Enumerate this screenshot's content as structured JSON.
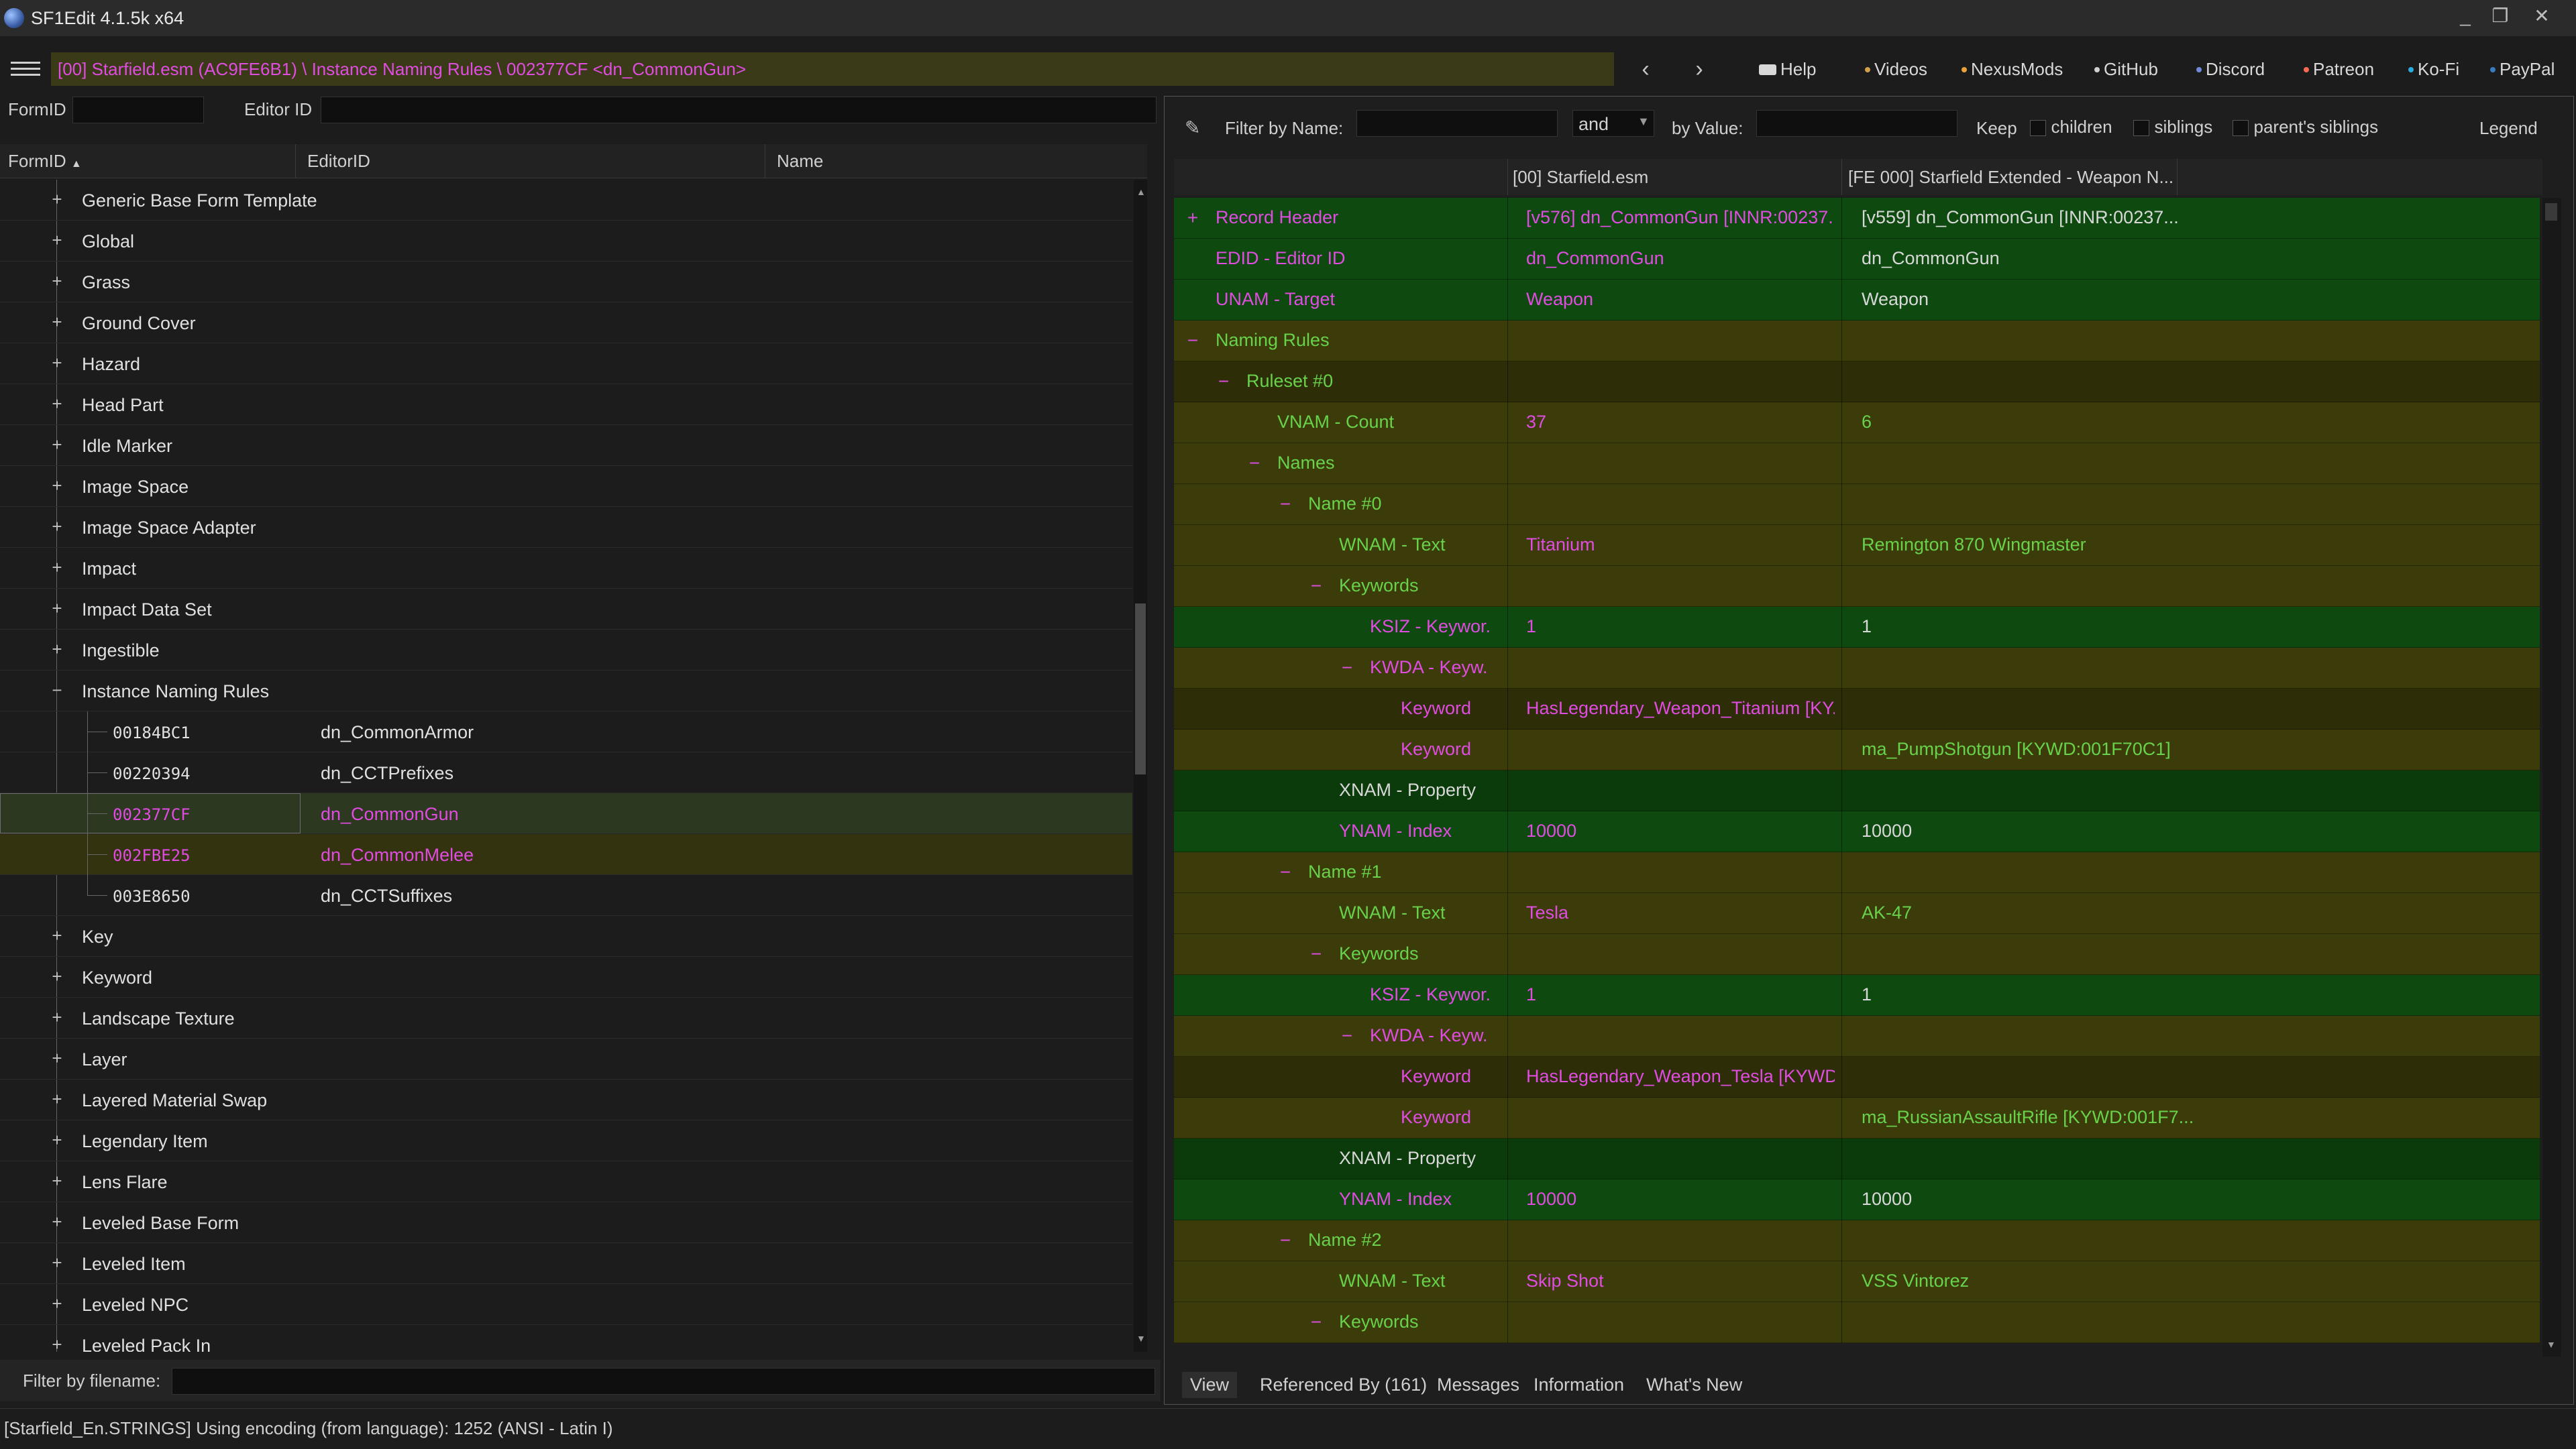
{
  "window": {
    "title": "SF1Edit 4.1.5k x64",
    "minimize": "_",
    "restore": "❐",
    "close": "✕"
  },
  "breadcrumb": "[00] Starfield.esm (AC9FE6B1) \\ Instance Naming Rules \\ 002377CF <dn_CommonGun>",
  "nav": {
    "back": "‹",
    "forward": "›"
  },
  "links": [
    {
      "label": "Help",
      "icon": "book-icon",
      "color": "#d8d8d8"
    },
    {
      "label": "Videos",
      "icon": "video-icon",
      "color": "#cfa04a"
    },
    {
      "label": "NexusMods",
      "icon": "nexus-icon",
      "color": "#e8a23a"
    },
    {
      "label": "GitHub",
      "icon": "github-icon",
      "color": "#d0d0d0"
    },
    {
      "label": "Discord",
      "icon": "discord-icon",
      "color": "#7289da"
    },
    {
      "label": "Patreon",
      "icon": "patreon-icon",
      "color": "#f96854"
    },
    {
      "label": "Ko-Fi",
      "icon": "kofi-icon",
      "color": "#29abe0"
    },
    {
      "label": "PayPal",
      "icon": "paypal-icon",
      "color": "#3b7bbf"
    }
  ],
  "left": {
    "formid_label": "FormID",
    "editorid_label": "Editor ID",
    "columns": {
      "formid": "FormID",
      "editorid": "EditorID",
      "name": "Name"
    },
    "sort_arrow": "▲",
    "tree": [
      {
        "text": "Generic Base Form Template",
        "level": 0,
        "exp": "+"
      },
      {
        "text": "Global",
        "level": 0,
        "exp": "+"
      },
      {
        "text": "Grass",
        "level": 0,
        "exp": "+"
      },
      {
        "text": "Ground Cover",
        "level": 0,
        "exp": "+"
      },
      {
        "text": "Hazard",
        "level": 0,
        "exp": "+"
      },
      {
        "text": "Head Part",
        "level": 0,
        "exp": "+"
      },
      {
        "text": "Idle Marker",
        "level": 0,
        "exp": "+"
      },
      {
        "text": "Image Space",
        "level": 0,
        "exp": "+"
      },
      {
        "text": "Image Space Adapter",
        "level": 0,
        "exp": "+"
      },
      {
        "text": "Impact",
        "level": 0,
        "exp": "+"
      },
      {
        "text": "Impact Data Set",
        "level": 0,
        "exp": "+"
      },
      {
        "text": "Ingestible",
        "level": 0,
        "exp": "+"
      },
      {
        "text": "Instance Naming Rules",
        "level": 0,
        "exp": "−"
      },
      {
        "text": "00184BC1",
        "editorid": "dn_CommonArmor",
        "level": 1,
        "style": "normal"
      },
      {
        "text": "00220394",
        "editorid": "dn_CCTPrefixes",
        "level": 1,
        "style": "normal"
      },
      {
        "text": "002377CF",
        "editorid": "dn_CommonGun",
        "level": 1,
        "style": "selected"
      },
      {
        "text": "002FBE25",
        "editorid": "dn_CommonMelee",
        "level": 1,
        "style": "override"
      },
      {
        "text": "003E8650",
        "editorid": "dn_CCTSuffixes",
        "level": 1,
        "style": "normal"
      },
      {
        "text": "Key",
        "level": 0,
        "exp": "+"
      },
      {
        "text": "Keyword",
        "level": 0,
        "exp": "+"
      },
      {
        "text": "Landscape Texture",
        "level": 0,
        "exp": "+"
      },
      {
        "text": "Layer",
        "level": 0,
        "exp": "+"
      },
      {
        "text": "Layered Material Swap",
        "level": 0,
        "exp": "+"
      },
      {
        "text": "Legendary Item",
        "level": 0,
        "exp": "+"
      },
      {
        "text": "Lens Flare",
        "level": 0,
        "exp": "+"
      },
      {
        "text": "Leveled Base Form",
        "level": 0,
        "exp": "+"
      },
      {
        "text": "Leveled Item",
        "level": 0,
        "exp": "+"
      },
      {
        "text": "Leveled NPC",
        "level": 0,
        "exp": "+"
      },
      {
        "text": "Leveled Pack In",
        "level": 0,
        "exp": "+"
      }
    ],
    "filter_label": "Filter by filename:"
  },
  "right": {
    "filter_name_label": "Filter by Name:",
    "and_value": "and",
    "filter_value_label": "by Value:",
    "keep_label": "Keep",
    "children_label": "children",
    "siblings_label": "siblings",
    "parent_siblings_label": "parent's siblings",
    "legend_label": "Legend",
    "columns": {
      "master": "[00] Starfield.esm",
      "plugin": "[FE 000] Starfield Extended - Weapon N..."
    },
    "rows": [
      {
        "label": "Record Header",
        "indent": 0,
        "exp": "+",
        "v1": "[v576] dn_CommonGun [INNR:00237...",
        "v2": "[v559] dn_CommonGun [INNR:00237...",
        "bg": "g",
        "c0": "pink",
        "c1": "pink",
        "c2": "white"
      },
      {
        "label": "EDID - Editor ID",
        "indent": 0,
        "v1": "dn_CommonGun",
        "v2": "dn_CommonGun",
        "bg": "g",
        "c0": "pink",
        "c1": "pink",
        "c2": "white"
      },
      {
        "label": "UNAM - Target",
        "indent": 0,
        "v1": "Weapon",
        "v2": "Weapon",
        "bg": "g",
        "c0": "pink",
        "c1": "pink",
        "c2": "white"
      },
      {
        "label": "Naming Rules",
        "indent": 0,
        "exp": "−",
        "v1": "",
        "v2": "",
        "bg": "y",
        "c0": "lgreen",
        "c1": "lgreen",
        "c2": "lgreen"
      },
      {
        "label": "Ruleset #0",
        "indent": 1,
        "exp": "−",
        "v1": "",
        "v2": "",
        "bg": "dy",
        "c0": "lgreen",
        "c1": "lgreen",
        "c2": "lgreen"
      },
      {
        "label": "VNAM - Count",
        "indent": 2,
        "v1": "37",
        "v2": "6",
        "bg": "y",
        "c0": "lgreen",
        "c1": "pink",
        "c2": "lgreen"
      },
      {
        "label": "Names",
        "indent": 2,
        "exp": "−",
        "v1": "",
        "v2": "",
        "bg": "y",
        "c0": "lgreen",
        "c1": "lgreen",
        "c2": "lgreen"
      },
      {
        "label": "Name #0",
        "indent": 3,
        "exp": "−",
        "v1": "",
        "v2": "",
        "bg": "y",
        "c0": "lgreen",
        "c1": "lgreen",
        "c2": "lgreen"
      },
      {
        "label": "WNAM - Text",
        "indent": 4,
        "v1": "Titanium",
        "v2": "Remington 870 Wingmaster",
        "bg": "y",
        "c0": "lgreen",
        "c1": "pink",
        "c2": "lgreen"
      },
      {
        "label": "Keywords",
        "indent": 4,
        "exp": "−",
        "v1": "",
        "v2": "",
        "bg": "y",
        "c0": "lgreen",
        "c1": "lgreen",
        "c2": "lgreen"
      },
      {
        "label": "KSIZ - Keywor...",
        "indent": 5,
        "v1": "1",
        "v2": "1",
        "bg": "g",
        "c0": "pink",
        "c1": "pink",
        "c2": "white"
      },
      {
        "label": "KWDA - Keyw...",
        "indent": 5,
        "exp": "−",
        "v1": "",
        "v2": "",
        "bg": "y",
        "c0": "pink",
        "c1": "pink",
        "c2": "pink"
      },
      {
        "label": "Keyword",
        "indent": 6,
        "v1": "HasLegendary_Weapon_Titanium [KY...",
        "v2": "",
        "bg": "dy",
        "c0": "pink",
        "c1": "pink",
        "c2": "pink"
      },
      {
        "label": "Keyword",
        "indent": 6,
        "v1": "",
        "v2": "ma_PumpShotgun [KYWD:001F70C1]",
        "bg": "y",
        "c0": "pink",
        "c1": "pink",
        "c2": "lgreen"
      },
      {
        "label": "XNAM - Property",
        "indent": 4,
        "v1": "",
        "v2": "",
        "bg": "dg",
        "c0": "white",
        "c1": "white",
        "c2": "white"
      },
      {
        "label": "YNAM - Index",
        "indent": 4,
        "v1": "10000",
        "v2": "10000",
        "bg": "g",
        "c0": "pink",
        "c1": "pink",
        "c2": "white"
      },
      {
        "label": "Name #1",
        "indent": 3,
        "exp": "−",
        "v1": "",
        "v2": "",
        "bg": "y",
        "c0": "lgreen",
        "c1": "lgreen",
        "c2": "lgreen"
      },
      {
        "label": "WNAM - Text",
        "indent": 4,
        "v1": "Tesla",
        "v2": "AK-47",
        "bg": "y",
        "c0": "lgreen",
        "c1": "pink",
        "c2": "lgreen"
      },
      {
        "label": "Keywords",
        "indent": 4,
        "exp": "−",
        "v1": "",
        "v2": "",
        "bg": "y",
        "c0": "lgreen",
        "c1": "lgreen",
        "c2": "lgreen"
      },
      {
        "label": "KSIZ - Keywor...",
        "indent": 5,
        "v1": "1",
        "v2": "1",
        "bg": "g",
        "c0": "pink",
        "c1": "pink",
        "c2": "white"
      },
      {
        "label": "KWDA - Keyw...",
        "indent": 5,
        "exp": "−",
        "v1": "",
        "v2": "",
        "bg": "y",
        "c0": "pink",
        "c1": "pink",
        "c2": "pink"
      },
      {
        "label": "Keyword",
        "indent": 6,
        "v1": "HasLegendary_Weapon_Tesla [KYWD...",
        "v2": "",
        "bg": "dy",
        "c0": "pink",
        "c1": "pink",
        "c2": "pink"
      },
      {
        "label": "Keyword",
        "indent": 6,
        "v1": "",
        "v2": "ma_RussianAssaultRifle [KYWD:001F7...",
        "bg": "y",
        "c0": "pink",
        "c1": "pink",
        "c2": "lgreen"
      },
      {
        "label": "XNAM - Property",
        "indent": 4,
        "v1": "",
        "v2": "",
        "bg": "dg",
        "c0": "white",
        "c1": "white",
        "c2": "white"
      },
      {
        "label": "YNAM - Index",
        "indent": 4,
        "v1": "10000",
        "v2": "10000",
        "bg": "g",
        "c0": "pink",
        "c1": "pink",
        "c2": "white"
      },
      {
        "label": "Name #2",
        "indent": 3,
        "exp": "−",
        "v1": "",
        "v2": "",
        "bg": "y",
        "c0": "lgreen",
        "c1": "lgreen",
        "c2": "lgreen"
      },
      {
        "label": "WNAM - Text",
        "indent": 4,
        "v1": "Skip Shot",
        "v2": "VSS Vintorez",
        "bg": "y",
        "c0": "lgreen",
        "c1": "pink",
        "c2": "lgreen"
      },
      {
        "label": "Keywords",
        "indent": 4,
        "exp": "−",
        "v1": "",
        "v2": "",
        "bg": "y",
        "c0": "lgreen",
        "c1": "lgreen",
        "c2": "lgreen"
      }
    ],
    "tabs": [
      "View",
      "Referenced By (161)",
      "Messages",
      "Information",
      "What's New"
    ]
  },
  "status": "[Starfield_En.STRINGS] Using encoding (from language): 1252  (ANSI - Latin I)"
}
